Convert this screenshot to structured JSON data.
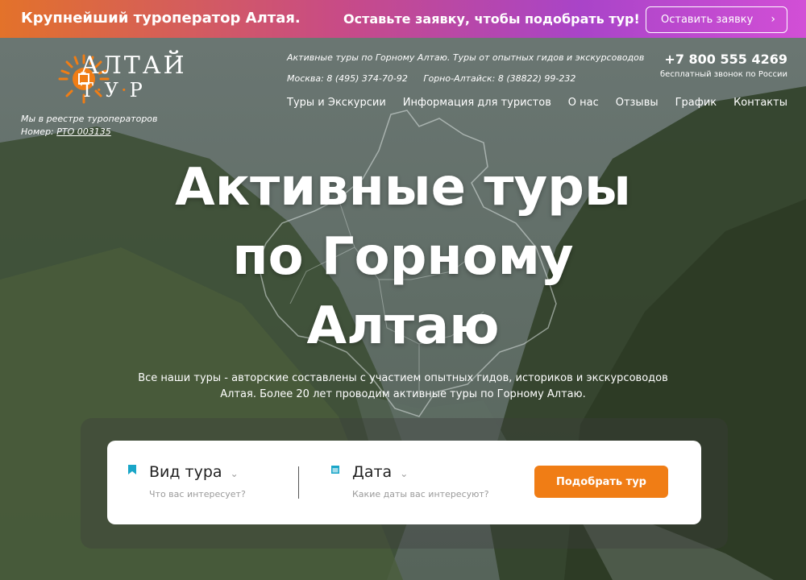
{
  "promo": {
    "left_text": "Крупнейший туроператор Алтая.",
    "mid_text": "Оставьте заявку, чтобы подобрать тур!",
    "button_label": "Оставить заявку"
  },
  "header": {
    "logo_line1": "АЛТАЙ",
    "logo_letters": [
      "Т",
      "У",
      "Р"
    ],
    "registry_line": "Мы в реестре туроператоров",
    "registry_label": "Номер:",
    "registry_number": "РТО 003135",
    "slogan": "Активные туры по Горному Алтаю. Туры от опытных гидов и экскурсоводов",
    "phone_moscow_label": "Москва:",
    "phone_moscow": "8 (495) 374-70-92",
    "phone_ga_label": "Горно-Алтайск:",
    "phone_ga": "8 (38822) 99-232",
    "hotline": "+7 800 555 4269",
    "hotline_sub": "бесплатный звонок по России",
    "nav": [
      "Туры и Экскурсии",
      "Информация для туристов",
      "О нас",
      "Отзывы",
      "График",
      "Контакты"
    ]
  },
  "hero": {
    "title_lines": [
      "Активные туры",
      "по Горному",
      "Алтаю"
    ],
    "subtitle_line1": "Все наши туры - авторские составлены с участием опытных гидов, историков и экскурсоводов",
    "subtitle_line2": "Алтая. Более 20 лет проводим активные туры по Горному Алтаю."
  },
  "search": {
    "tour_type": {
      "title": "Вид тура",
      "hint": "Что вас интересует?",
      "icon": "bookmark-icon"
    },
    "date": {
      "title": "Дата",
      "hint": "Какие даты вас интересуют?",
      "icon": "calendar-icon"
    },
    "button": "Подобрать тур"
  },
  "colors": {
    "accent": "#f07d15",
    "promo_start": "#e3722a",
    "promo_end": "#d24fd6",
    "icon_blue": "#1aa6c8"
  }
}
